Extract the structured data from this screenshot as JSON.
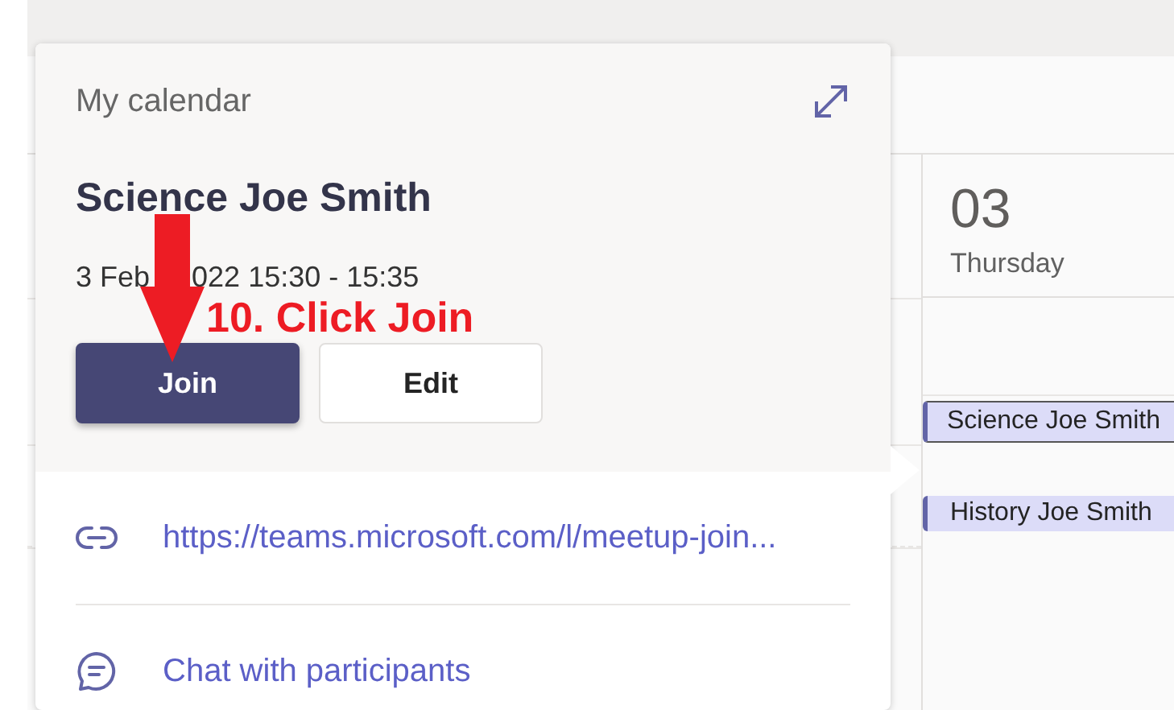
{
  "calendar": {
    "day": {
      "number": "03",
      "weekday": "Thursday"
    },
    "events": [
      {
        "title": "Science Joe Smith",
        "selected": true
      },
      {
        "title": "History Joe Smith",
        "selected": false
      }
    ]
  },
  "popup": {
    "calendar_name": "My calendar",
    "title": "Science Joe Smith",
    "time_parts": [
      "3 Feb",
      "022 15:30 - 15:35"
    ],
    "buttons": [
      {
        "label": "Join",
        "kind": "primary"
      },
      {
        "label": "Edit",
        "kind": "secondary"
      }
    ],
    "links": [
      {
        "kind": "link",
        "text": "https://teams.microsoft.com/l/meetup-join..."
      },
      {
        "kind": "chat",
        "text": "Chat with participants"
      }
    ]
  },
  "annotation": {
    "text": "10. Click Join"
  }
}
